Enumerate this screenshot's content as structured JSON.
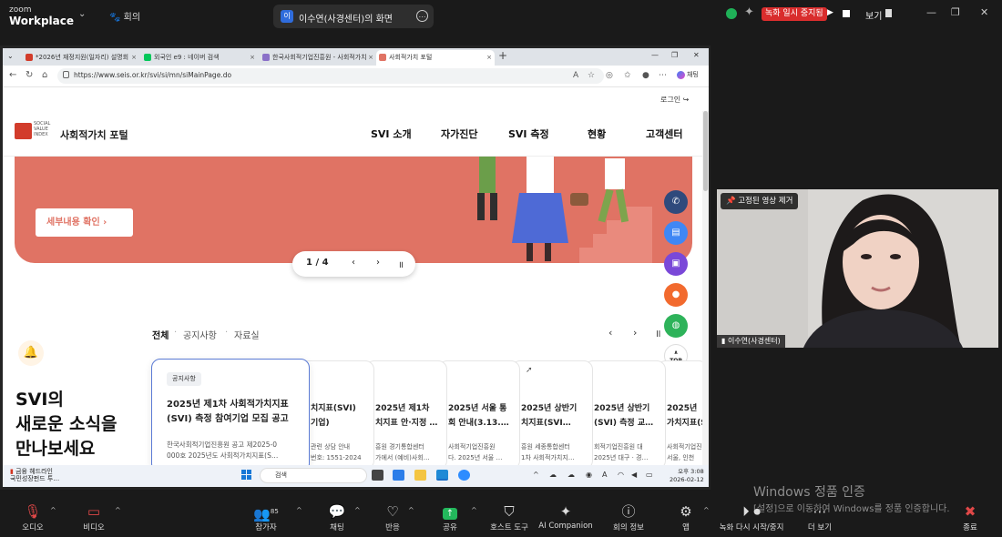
{
  "zoom": {
    "logo_top": "zoom",
    "logo_bottom": "Workplace",
    "meeting_label": "회의",
    "share_tab_initial": "이",
    "share_tab_title": "이수연(사경센터)의 화면",
    "recording_badge": "녹화 일시 중지됨",
    "view_label": "보기"
  },
  "browser": {
    "tabs": [
      {
        "label": "*2026년 재정지원(일자리) 설명회"
      },
      {
        "label": "외국인 e9 : 네이버 검색"
      },
      {
        "label": "한국사회적기업진흥원 - 사회적가치"
      },
      {
        "label": "사회적가치 포털"
      }
    ],
    "url": "https://www.seis.or.kr/svi/si/mn/siMainPage.do",
    "copilot_label": "채팅"
  },
  "site": {
    "login": "로그인",
    "logo_lines": [
      "SOCIAL",
      "VALUE",
      "INDEX"
    ],
    "title": "사회적가치 포털",
    "nav": [
      "SVI 소개",
      "자가진단",
      "SVI 측정",
      "현황",
      "고객센터"
    ],
    "banner_button": "세부내용 확인  ›",
    "pager": {
      "current": "1 / 4"
    },
    "news_tabs": [
      "전체",
      "공지사항",
      "자료실"
    ],
    "headline_lines": [
      "SVI의",
      "새로운 소식을",
      "만나보세요"
    ],
    "cards": [
      {
        "tag": "공지사항",
        "title": [
          "2025년 제1차 사회적가치지표",
          "(SVI) 측정 참여기업 모집 공고"
        ],
        "body": [
          "한국사회적기업진흥원 공고 제2025-0",
          "000호 2025년도 사회적가치지표(S…"
        ]
      },
      {
        "title": [
          "치지표(SVI)",
          "기업)"
        ],
        "body": [
          "관련 상담 안내",
          "번호: 1551-2024"
        ]
      },
      {
        "title": [
          "2025년 제1차",
          "치지표 안·지정 …"
        ],
        "body": [
          "흥원 경기통합센터",
          "가에서 (예비)사회…"
        ]
      },
      {
        "title": [
          "2025년 서울 통",
          "회 안내(3.13.…"
        ],
        "body": [
          "사회적기업진흥원",
          "다. 2025년 서울 …"
        ]
      },
      {
        "title": [
          "2025년 상반기",
          "치지표(SVI…"
        ],
        "body": [
          "흥원 세종통합센터",
          "1차 사회적가치지…"
        ]
      },
      {
        "title": [
          "2025년 상반기",
          "(SVI) 측정 교…"
        ],
        "body": [
          "회적기업진흥원 대",
          "2025년 대구 · 경…"
        ]
      },
      {
        "title": [
          "2025년",
          "가치지표(S"
        ],
        "body": [
          "사회적기업진",
          "서울, 인천"
        ]
      }
    ],
    "top_label": "TOP"
  },
  "taskbar": {
    "weather_title": "금융 헤드라인",
    "weather_sub": "국민성장펀드 투…",
    "search": "검색",
    "time": "오후 3:08",
    "date": "2026-02-12"
  },
  "video": {
    "pin_label": "고정된 영상 제거",
    "name": "이수연(사경센터)"
  },
  "watermark": {
    "title": "Windows 정품 인증",
    "sub": "[설정]으로 이동하여 Windows를 정품 인증합니다."
  },
  "toolbar": [
    {
      "label": "오디오"
    },
    {
      "label": "비디오"
    },
    {
      "label": "참가자",
      "count": "85"
    },
    {
      "label": "채팅"
    },
    {
      "label": "반응"
    },
    {
      "label": "공유"
    },
    {
      "label": "호스트 도구"
    },
    {
      "label": "AI Companion"
    },
    {
      "label": "회의 정보"
    },
    {
      "label": "앱"
    },
    {
      "label": "녹화 다시 시작/중지"
    },
    {
      "label": "더 보기"
    },
    {
      "label": "종료"
    }
  ],
  "colors": {
    "banner": "#e07364",
    "record": "#d92d2d",
    "card_active": "#5b7bd5"
  }
}
